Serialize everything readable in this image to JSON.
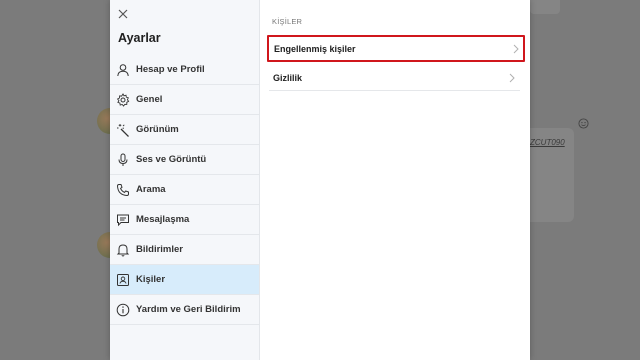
{
  "background": {
    "link_text": "ZCUT090"
  },
  "settings": {
    "title": "Ayarlar",
    "close_icon": "close-icon",
    "nav_items": [
      {
        "label": "Hesap ve Profil",
        "icon": "person-icon"
      },
      {
        "label": "Genel",
        "icon": "gear-icon"
      },
      {
        "label": "Görünüm",
        "icon": "magic-wand-icon"
      },
      {
        "label": "Ses ve Görüntü",
        "icon": "microphone-icon"
      },
      {
        "label": "Arama",
        "icon": "phone-icon"
      },
      {
        "label": "Mesajlaşma",
        "icon": "chat-icon"
      },
      {
        "label": "Bildirimler",
        "icon": "bell-icon"
      },
      {
        "label": "Kişiler",
        "icon": "contact-card-icon",
        "active": true
      },
      {
        "label": "Yardım ve Geri Bildirim",
        "icon": "info-icon"
      }
    ],
    "active_color": "#d7ecfb"
  },
  "contacts_panel": {
    "section_header": "KİŞİLER",
    "rows": [
      {
        "label": "Engellenmiş kişiler",
        "highlighted": true,
        "highlight_color": "#d0161c"
      },
      {
        "label": "Gizlilik",
        "highlighted": false
      }
    ]
  }
}
